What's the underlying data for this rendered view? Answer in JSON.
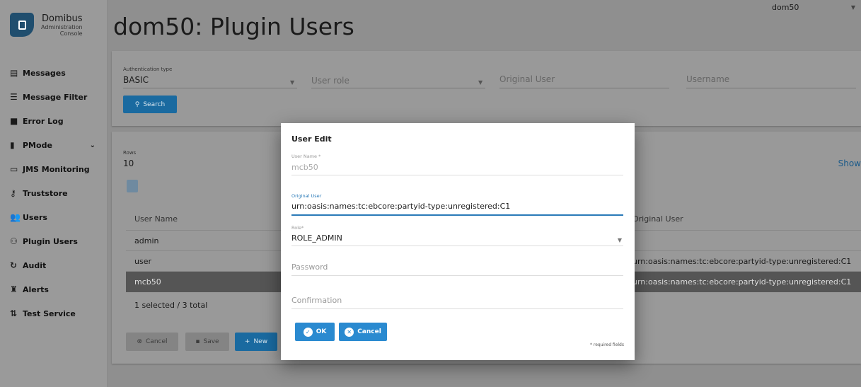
{
  "brand": {
    "title": "Domibus",
    "subtitle1": "Administration",
    "subtitle2": "Console"
  },
  "sidebar": {
    "items": [
      {
        "label": "Messages",
        "icon": "message-icon"
      },
      {
        "label": "Message Filter",
        "icon": "filter-icon"
      },
      {
        "label": "Error Log",
        "icon": "error-icon"
      },
      {
        "label": "PMode",
        "icon": "document-icon"
      },
      {
        "label": "JMS Monitoring",
        "icon": "monitor-icon"
      },
      {
        "label": "Truststore",
        "icon": "key-icon"
      },
      {
        "label": "Users",
        "icon": "users-icon"
      },
      {
        "label": "Plugin Users",
        "icon": "plugin-users-icon"
      },
      {
        "label": "Audit",
        "icon": "audit-icon"
      },
      {
        "label": "Alerts",
        "icon": "bell-icon"
      },
      {
        "label": "Test Service",
        "icon": "test-icon"
      }
    ]
  },
  "header": {
    "title": "dom50: Plugin Users",
    "domain": "dom50"
  },
  "filters": {
    "auth_label": "Authentication type",
    "auth_value": "BASIC",
    "role_placeholder": "User role",
    "original_user_placeholder": "Original User",
    "username_placeholder": "Username",
    "search_label": "Search"
  },
  "results": {
    "rows_label": "Rows",
    "rows_value": "10",
    "show_link": "Show",
    "columns": [
      "User Name",
      "Original User"
    ],
    "rows": [
      {
        "name": "admin",
        "original": ""
      },
      {
        "name": "user",
        "original": "urn:oasis:names:tc:ebcore:partyid-type:unregistered:C1"
      },
      {
        "name": "mcb50",
        "original": "urn:oasis:names:tc:ebcore:partyid-type:unregistered:C1"
      }
    ],
    "selection": "1 selected / 3 total",
    "cancel_label": "Cancel",
    "save_label": "Save",
    "new_label": "New"
  },
  "modal": {
    "title": "User Edit",
    "username_label": "User Name *",
    "username_value": "mcb50",
    "original_label": "Original User",
    "original_value": "urn:oasis:names:tc:ebcore:partyid-type:unregistered:C1",
    "role_label": "Role*",
    "role_value": "ROLE_ADMIN",
    "password_placeholder": "Password",
    "confirmation_placeholder": "Confirmation",
    "ok_label": "OK",
    "cancel_label": "Cancel",
    "required_note": "* required fields"
  },
  "colors": {
    "primary": "#2a8ad0",
    "brand": "#204e6e"
  }
}
